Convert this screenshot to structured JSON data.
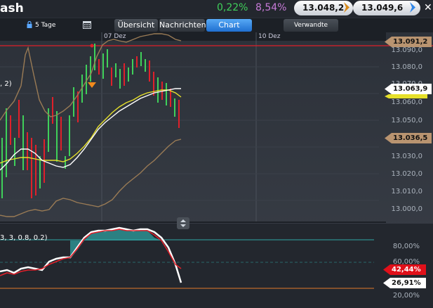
{
  "header": {
    "title": "ash",
    "change_pct": "0,22%",
    "change_pct_alt": "8,54%",
    "bid": "13.048,2",
    "ask": "13.049,6"
  },
  "tabs": [
    {
      "label": "Übersicht"
    },
    {
      "label": "Nachrichten"
    },
    {
      "label": "Chart"
    },
    {
      "label": "Verwandte"
    }
  ],
  "toolbar": {
    "period": "5 Tage"
  },
  "chart": {
    "date_labels": [
      "07 Dez",
      "10 Dez"
    ],
    "y_ticks": [
      "13.090,0",
      "13.080,0",
      "13.070,0",
      "13.060,0",
      "13.050,0",
      "13.040,0",
      "13.030,0",
      "13.020,0",
      "13.010,0",
      "13.000,0"
    ],
    "price_tags": {
      "upper_band": "13.091,2",
      "ma": "13.063,9",
      "lower_band": "13.036,5"
    },
    "study_label": ", 2)"
  },
  "indicator": {
    "label": "3, 3, 0.8, 0.2)",
    "y_ticks": [
      "80,00%",
      "60,00%",
      "20,00%"
    ],
    "tags": {
      "k": "42,44%",
      "d": "26,91%"
    }
  },
  "colors": {
    "accent_tab": "#2f86e8",
    "up": "#3fd05a",
    "down": "#e0202a",
    "band": "#9a7b55",
    "ma_white": "#ffffff",
    "ma_yellow": "#e6e02a"
  },
  "chart_data": {
    "type": "line",
    "ylim": [
      12996,
      13093
    ],
    "x_dates": [
      "07 Dez",
      "10 Dez"
    ],
    "series": [],
    "price_levels": [
      13091.2,
      13063.9,
      13036.5
    ],
    "indicator_levels_pct": [
      80,
      60,
      20
    ]
  }
}
